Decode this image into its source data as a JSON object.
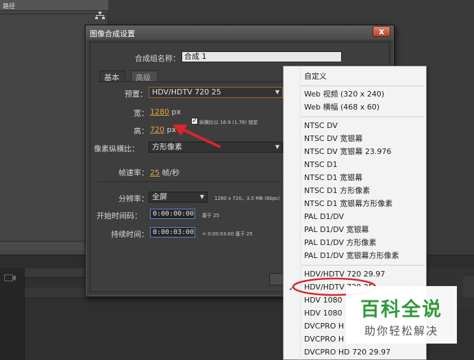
{
  "background": {
    "panel_header": "路径"
  },
  "dialog": {
    "title": "图像合成设置",
    "close_glyph": "x",
    "name_label": "合成组名称：",
    "name_value": "合成 1",
    "tabs": [
      "基本",
      "高级"
    ],
    "preset_label": "预置：",
    "preset_value": "HDV/HDTV 720 25",
    "width_label": "宽：",
    "width_value": "1280",
    "height_label": "高：",
    "height_value": "720",
    "px_unit": "px",
    "lock_label": "纵横比以 16:9 (1.78) 锁定",
    "lock_checked": true,
    "par_label": "像素纵横比：",
    "par_value": "方形像素",
    "fps_label": "帧速率：",
    "fps_value": "25",
    "fps_unit": "帧/秒",
    "res_label": "分辨率：",
    "res_value": "全屏",
    "res_info": "1280 x 720，3.5 MB (8bpc/",
    "start_label": "开始时间码：",
    "start_value": "0:00:00:00",
    "start_base": "基于 25",
    "duration_label": "持续时间：",
    "duration_value": "0:00:03:00",
    "duration_info": "= 0:00:03:00  基于 25"
  },
  "menu": {
    "items": [
      "自定义",
      "Web 视频 (320 x 240)",
      "Web 横幅 (468 x 60)",
      "NTSC DV",
      "NTSC DV 宽银幕",
      "NTSC DV 宽银幕 23.976",
      "NTSC D1",
      "NTSC D1 宽银幕",
      "NTSC D1 方形像素",
      "NTSC D1 宽银幕方形像素",
      "PAL D1/DV",
      "PAL D1/DV 宽银幕",
      "PAL D1/DV 方形像素",
      "PAL D1/DV 宽银幕方形像素",
      "HDV/HDTV 720 29.97",
      "HDV/HDTV 720 25",
      "HDV 1080",
      "HDV 1080",
      "DVCPRO H",
      "DVCPRO H",
      "DVCPRO HD 720 29.97"
    ],
    "selected_index": 15,
    "check_glyph": "✓"
  },
  "watermark": {
    "title": "百科全说",
    "subtitle": "助你轻松解决"
  },
  "colors": {
    "accent_orange": "#e5a93f",
    "annotation_red": "#d8262c",
    "watermark_green": "#2f9a3a"
  }
}
